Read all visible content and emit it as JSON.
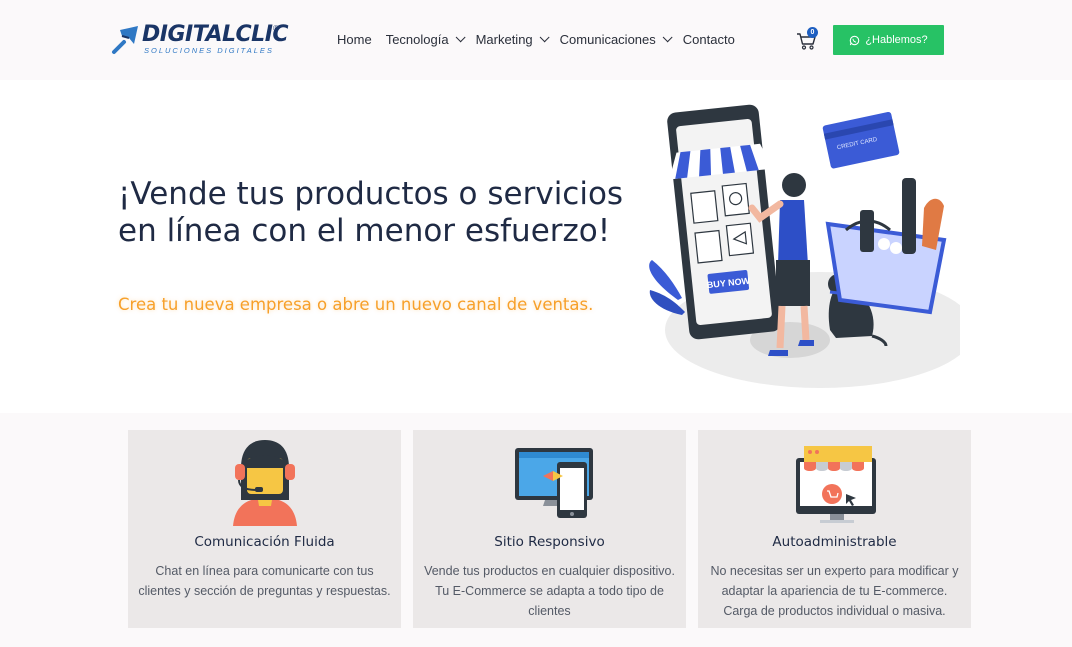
{
  "header": {
    "logo_text": "DIGITALCLIC",
    "logo_reg": "®",
    "logo_tagline": "SOLUCIONES DIGITALES",
    "nav": [
      {
        "label": "Home",
        "has_dropdown": false
      },
      {
        "label": "Tecnología",
        "has_dropdown": true
      },
      {
        "label": "Marketing",
        "has_dropdown": true
      },
      {
        "label": "Comunicaciones",
        "has_dropdown": true
      },
      {
        "label": "Contacto",
        "has_dropdown": false
      }
    ],
    "cart_count": "0",
    "cta_label": "¿Hablemos?",
    "cta_icon": "whatsapp-icon"
  },
  "hero": {
    "title": "¡Vende tus productos o servicios en línea con el menor esfuerzo!",
    "subtitle": "Crea tu nueva empresa o abre un nuevo canal de ventas.",
    "illustration_labels": {
      "buy_now": "BUY NOW",
      "credit_card": "CREDIT CARD"
    }
  },
  "features": [
    {
      "icon": "support-agent-icon",
      "title": "Comunicación Fluida",
      "description": "Chat en línea para comunicarte con tus clientes y sección de preguntas y respuestas."
    },
    {
      "icon": "responsive-devices-icon",
      "title": "Sitio Responsivo",
      "description": "Vende tus productos en cualquier dispositivo. Tu E-Commerce se adapta a todo tipo de clientes"
    },
    {
      "icon": "online-store-icon",
      "title": "Autoadministrable",
      "description": "No necesitas ser un experto para modificar y adaptar la apariencia de tu E-commerce. Carga de productos individual o masiva."
    }
  ],
  "colors": {
    "brand_navy": "#1a3566",
    "brand_blue": "#2f78c4",
    "cta_green": "#27c265",
    "accent_orange": "#f7a02a",
    "card_bg": "#ebe8e8"
  }
}
